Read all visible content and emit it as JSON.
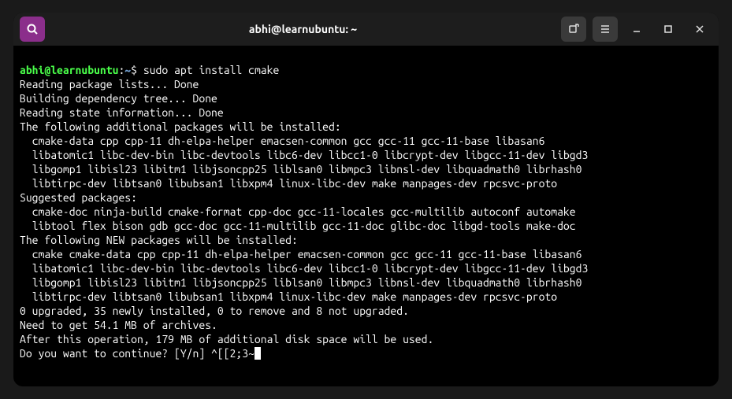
{
  "title": "abhi@learnubuntu: ~",
  "prompt": {
    "user_host": "abhi@learnubuntu",
    "path": "~",
    "command": "sudo apt install cmake"
  },
  "output": [
    "Reading package lists... Done",
    "Building dependency tree... Done",
    "Reading state information... Done",
    "The following additional packages will be installed:",
    "  cmake-data cpp cpp-11 dh-elpa-helper emacsen-common gcc gcc-11 gcc-11-base libasan6",
    "  libatomic1 libc-dev-bin libc-devtools libc6-dev libcc1-0 libcrypt-dev libgcc-11-dev libgd3",
    "  libgomp1 libisl23 libitm1 libjsoncpp25 liblsan0 libmpc3 libnsl-dev libquadmath0 librhash0",
    "  libtirpc-dev libtsan0 libubsan1 libxpm4 linux-libc-dev make manpages-dev rpcsvc-proto",
    "Suggested packages:",
    "  cmake-doc ninja-build cmake-format cpp-doc gcc-11-locales gcc-multilib autoconf automake",
    "  libtool flex bison gdb gcc-doc gcc-11-multilib gcc-11-doc glibc-doc libgd-tools make-doc",
    "The following NEW packages will be installed:",
    "  cmake cmake-data cpp cpp-11 dh-elpa-helper emacsen-common gcc gcc-11 gcc-11-base libasan6",
    "  libatomic1 libc-dev-bin libc-devtools libc6-dev libcc1-0 libcrypt-dev libgcc-11-dev libgd3",
    "  libgomp1 libisl23 libitm1 libjsoncpp25 liblsan0 libmpc3 libnsl-dev libquadmath0 librhash0",
    "  libtirpc-dev libtsan0 libubsan1 libxpm4 linux-libc-dev make manpages-dev rpcsvc-proto",
    "0 upgraded, 35 newly installed, 0 to remove and 8 not upgraded.",
    "Need to get 54.1 MB of archives.",
    "After this operation, 179 MB of additional disk space will be used."
  ],
  "continue_prompt": "Do you want to continue? [Y/n] ^[[2;3~"
}
